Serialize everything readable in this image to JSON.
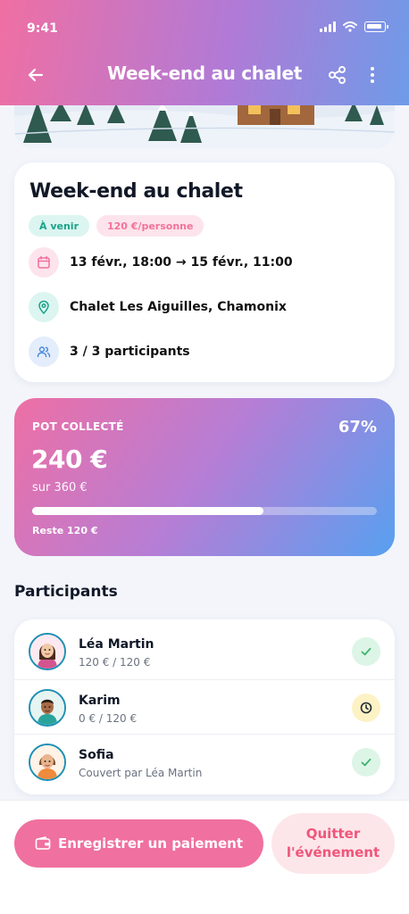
{
  "status_bar": {
    "time": "9:41"
  },
  "header": {
    "title": "Week-end au chalet"
  },
  "event": {
    "title": "Week-end au chalet",
    "badges": {
      "status": "À venir",
      "price": "120 €/personne"
    },
    "date": "13 févr., 18:00 → 15 févr., 11:00",
    "location": "Chalet Les Aiguilles, Chamonix",
    "participants": "3 / 3 participants"
  },
  "pot": {
    "label": "POT COLLECTÉ",
    "percent_label": "67%",
    "progress": 0.67,
    "amount": "240 €",
    "target": "sur 360 €",
    "remaining": "Reste 120 €"
  },
  "participants_section": {
    "title": "Participants",
    "list": [
      {
        "name": "Léa Martin",
        "detail": "120 € / 120 €",
        "status": "paid"
      },
      {
        "name": "Karim",
        "detail": "0 € / 120 €",
        "status": "pending"
      },
      {
        "name": "Sofia",
        "detail": "Couvert par Léa Martin",
        "status": "paid"
      }
    ]
  },
  "actions": {
    "pay_label": "Enregistrer un paiement",
    "leave_line1": "Quitter",
    "leave_line2": "l'événement"
  },
  "colors": {
    "primary_pink": "#f0709f",
    "blue": "#58a0f0",
    "success": "#3cb371",
    "pending": "#1f2937"
  }
}
